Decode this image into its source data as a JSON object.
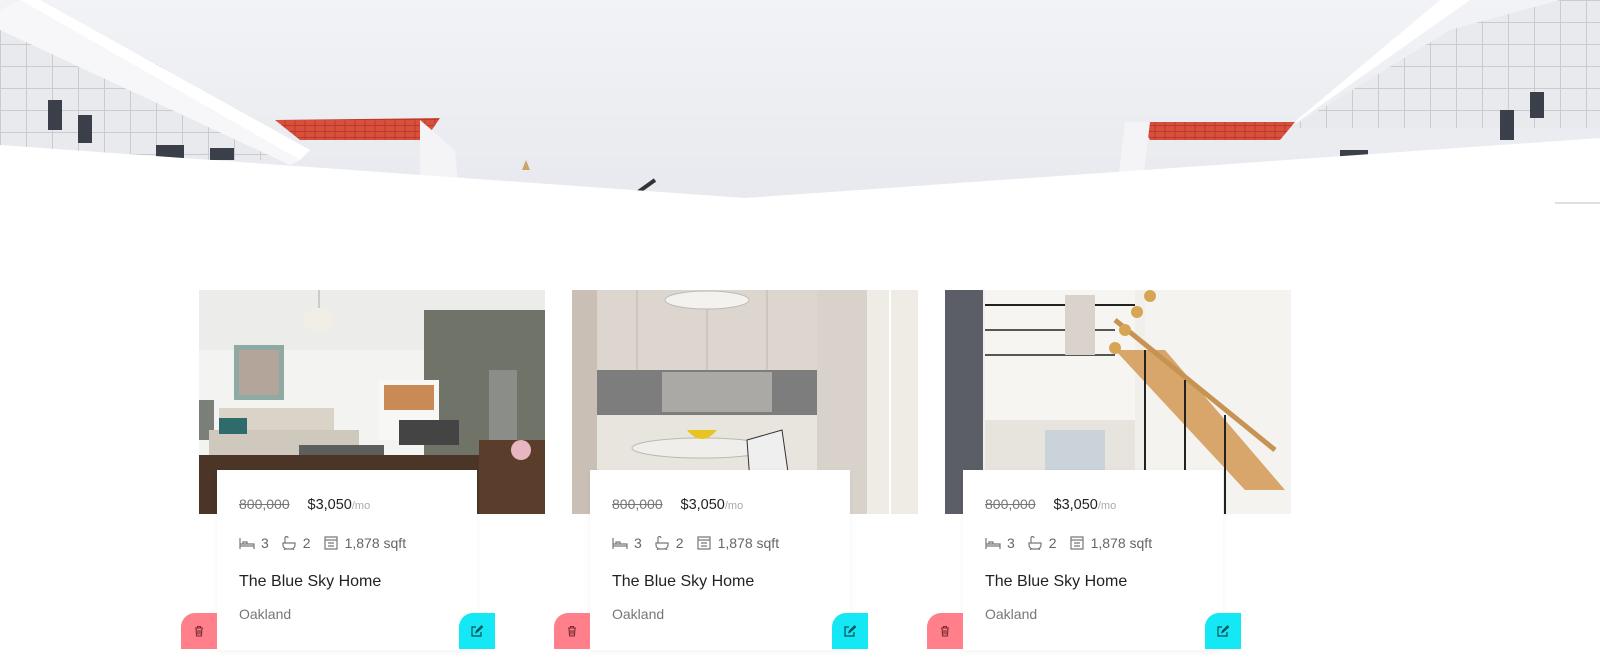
{
  "listings": [
    {
      "old_price": "800,000",
      "price": "$3,050",
      "per": "/mo",
      "beds": "3",
      "baths": "2",
      "area": "1,878 sqft",
      "title": "The Blue Sky Home",
      "city": "Oakland"
    },
    {
      "old_price": "800,000",
      "price": "$3,050",
      "per": "/mo",
      "beds": "3",
      "baths": "2",
      "area": "1,878 sqft",
      "title": "The Blue Sky Home",
      "city": "Oakland"
    },
    {
      "old_price": "800,000",
      "price": "$3,050",
      "per": "/mo",
      "beds": "3",
      "baths": "2",
      "area": "1,878 sqft",
      "title": "The Blue Sky Home",
      "city": "Oakland"
    }
  ],
  "icons": {
    "bed": "bed-icon",
    "bath": "bath-icon",
    "area": "area-icon",
    "delete": "trash-icon",
    "edit": "edit-icon"
  },
  "colors": {
    "delete_button": "#ff7f8a",
    "edit_button": "#14e8f4"
  }
}
